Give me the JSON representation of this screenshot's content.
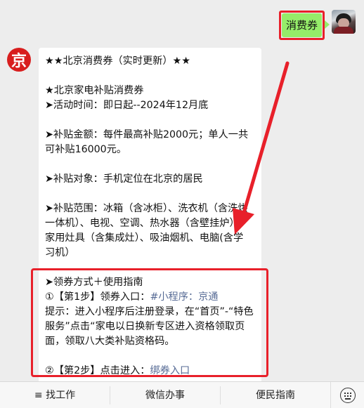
{
  "sent_message": {
    "text": "消费券"
  },
  "bot_avatar": {
    "glyph": "京"
  },
  "message": {
    "title": "★★北京消费券（实时更新）★★",
    "subtitle": "★北京家电补贴消费券",
    "activity_time": "➤活动时间：即日起--2024年12月底",
    "amount_1": "➤补贴金额：每件最高补贴2000元；单人一共",
    "amount_2": "可补贴16000元。",
    "target": "➤补贴对象：手机定位在北京的居民",
    "scope_1": "➤补贴范围：冰箱（含冰柜）、洗衣机（含洗烘",
    "scope_2": "一体机）、电视、空调、热水器（含壁挂炉）、",
    "scope_3": "家用灶具（含集成灶）、吸油烟机、电脑(含学",
    "scope_4": "习机）",
    "guide_title": "➤领券方式＋使用指南",
    "step1_prefix": "①【第1步】领券入口：",
    "step1_link": "#小程序：京通",
    "tip_1": "提示：进入小程序后注册登录，在“首页”-“特色",
    "tip_2": "服务”点击“家电以日换新专区进入资格领取页",
    "tip_3": "面，领取八大类补贴资格码。",
    "step2_prefix": "②【第2步】点击进入：",
    "step2_link": "绑券入口"
  },
  "menu": {
    "item_1": "≡ 找工作",
    "item_2": "微信办事",
    "item_3": "便民指南"
  },
  "colors": {
    "sent_bubble": "#95ec69",
    "highlight": "#e8202a",
    "link": "#576b95",
    "bot_avatar": "#d81e1e"
  },
  "icons": [
    "user-avatar",
    "jing-logo-icon",
    "keyboard-icon",
    "red-arrow-annotation"
  ]
}
